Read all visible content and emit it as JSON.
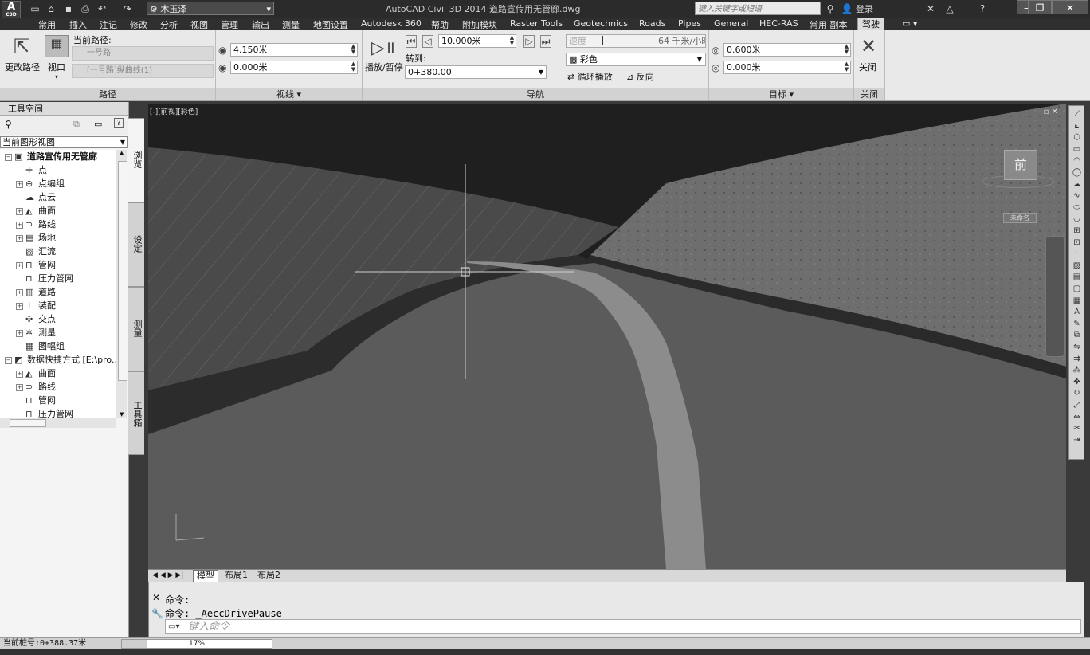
{
  "titlebar": {
    "app_menu": "A",
    "app_menu_sub": "C3D",
    "workspace": "木玉泽",
    "window_title": "AutoCAD Civil 3D 2014   道路宣传用无管廊.dwg",
    "search_placeholder": "键入关键字或短语",
    "login": "登录",
    "minimize": "—",
    "restore": "❐",
    "close": "✕"
  },
  "tabs": [
    "常用",
    "插入",
    "注记",
    "修改",
    "分析",
    "视图",
    "管理",
    "输出",
    "测量",
    "地图设置",
    "Autodesk 360",
    "帮助",
    "附加模块",
    "Raster Tools",
    "Geotechnics",
    "Roads",
    "Pipes",
    "General",
    "HEC-RAS",
    "常用 副本",
    "驾驶"
  ],
  "active_tab": "驾驶",
  "ribbon": {
    "path_panel": {
      "change_path": "更改路径",
      "viewport": "视口",
      "current_path_label": "当前路径:",
      "path_value": "一号路",
      "profile_value": "[一号路]纵曲线(1)",
      "title": "路径"
    },
    "sightline_panel": {
      "height_value": "4.150米",
      "offset_value": "0.000米",
      "title": "视线 ▾"
    },
    "navigation_panel": {
      "play_pause": "播放/暂停",
      "distance_value": "10.000米",
      "goto_label": "转到:",
      "goto_value": "0+380.00",
      "speed_label": "速度",
      "speed_value": "64 千米/小时",
      "color_mode": "彩色",
      "loop_play": "循环播放",
      "reverse": "反向",
      "title": "导航"
    },
    "target_panel": {
      "target_height": "0.600米",
      "target_offset": "0.000米",
      "title": "目标 ▾"
    },
    "close_panel": {
      "close": "关闭",
      "title": "关闭"
    }
  },
  "toolspace": {
    "title": "工具空间",
    "view_selector": "当前图形视图",
    "tree": [
      {
        "label": "道路宣传用无管廊",
        "level": 0,
        "expander": "⊟",
        "bold": true,
        "icon": "drawing-icon"
      },
      {
        "label": "点",
        "level": 1,
        "expander": "",
        "icon": "point-icon"
      },
      {
        "label": "点编组",
        "level": 1,
        "expander": "⊞",
        "icon": "point-group-icon"
      },
      {
        "label": "点云",
        "level": 1,
        "expander": "",
        "icon": "point-cloud-icon"
      },
      {
        "label": "曲面",
        "level": 1,
        "expander": "⊞",
        "icon": "surface-icon"
      },
      {
        "label": "路线",
        "level": 1,
        "expander": "⊞",
        "icon": "alignment-icon"
      },
      {
        "label": "场地",
        "level": 1,
        "expander": "⊞",
        "icon": "site-icon"
      },
      {
        "label": "汇流",
        "level": 1,
        "expander": "",
        "icon": "catchment-icon"
      },
      {
        "label": "管网",
        "level": 1,
        "expander": "⊞",
        "icon": "pipe-network-icon"
      },
      {
        "label": "压力管网",
        "level": 1,
        "expander": "",
        "icon": "pressure-network-icon"
      },
      {
        "label": "道路",
        "level": 1,
        "expander": "⊞",
        "icon": "corridor-icon"
      },
      {
        "label": "装配",
        "level": 1,
        "expander": "⊞",
        "icon": "assembly-icon"
      },
      {
        "label": "交点",
        "level": 1,
        "expander": "",
        "icon": "intersection-icon"
      },
      {
        "label": "测量",
        "level": 1,
        "expander": "⊞",
        "icon": "survey-icon"
      },
      {
        "label": "图幅组",
        "level": 1,
        "expander": "",
        "icon": "view-frame-icon"
      },
      {
        "label": "数据快捷方式 [E:\\pro...",
        "level": 0,
        "expander": "⊟",
        "bold": false,
        "icon": "data-shortcut-icon"
      },
      {
        "label": "曲面",
        "level": 1,
        "expander": "⊞",
        "icon": "surface-icon"
      },
      {
        "label": "路线",
        "level": 1,
        "expander": "⊞",
        "icon": "alignment-icon"
      },
      {
        "label": "管网",
        "level": 1,
        "expander": "",
        "icon": "pipe-network-icon"
      },
      {
        "label": "压力管网",
        "level": 1,
        "expander": "",
        "icon": "pressure-network-icon"
      }
    ],
    "side_tabs": [
      "浏览",
      "设定",
      "测量",
      "工具箱"
    ]
  },
  "viewport": {
    "label": "[-][前视][彩色]",
    "viewcube_face": "前",
    "viewcube_sub": "未命名",
    "controls": "– ▫ ✕"
  },
  "layout_tabs": [
    "模型",
    "布局1",
    "布局2"
  ],
  "command": {
    "line1": "命令:",
    "line2": "命令: _AeccDrivePause",
    "placeholder": "键入命令"
  },
  "status": {
    "station": "当前桩号:0+388.37米",
    "progress_text": "17%",
    "progress": 0.17
  }
}
